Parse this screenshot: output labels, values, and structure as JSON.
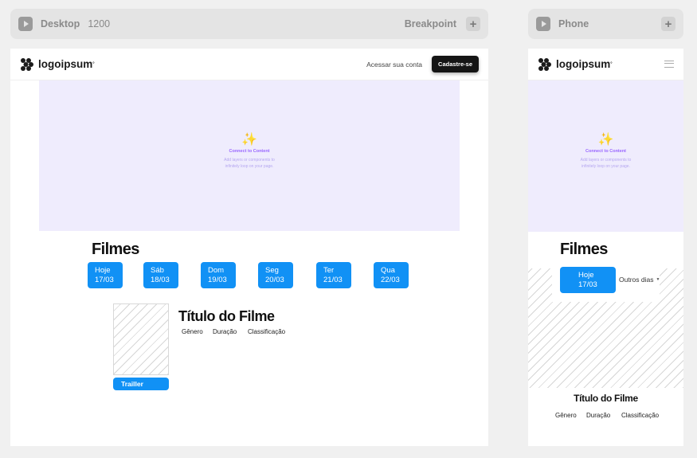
{
  "desktop_bar": {
    "label": "Desktop",
    "width": "1200",
    "breakpoint_label": "Breakpoint"
  },
  "phone_bar": {
    "label": "Phone"
  },
  "nav": {
    "logo": "logoipsum",
    "login": "Acessar sua conta",
    "signup": "Cadastre-se"
  },
  "ticker": {
    "icon": "✨",
    "title": "Connect to Content",
    "subtitle_line1": "Add layers or components to",
    "subtitle_line2": "infinitely loop on your page."
  },
  "section": {
    "title": "Filmes"
  },
  "days": [
    {
      "name": "Hoje",
      "date": "17/03"
    },
    {
      "name": "Sáb",
      "date": "18/03"
    },
    {
      "name": "Dom",
      "date": "19/03"
    },
    {
      "name": "Seg",
      "date": "20/03"
    },
    {
      "name": "Ter",
      "date": "21/03"
    },
    {
      "name": "Qua",
      "date": "22/03"
    }
  ],
  "phone_other_days": "Outros dias",
  "movie": {
    "title": "Título do Filme",
    "genre": "Gênero",
    "duration": "Duração",
    "rating": "Classificação",
    "trailer": "Trailler"
  },
  "colors": {
    "accent": "#1191f5",
    "ticker_bg": "#efecfd",
    "ticker_text": "#9966ff"
  }
}
